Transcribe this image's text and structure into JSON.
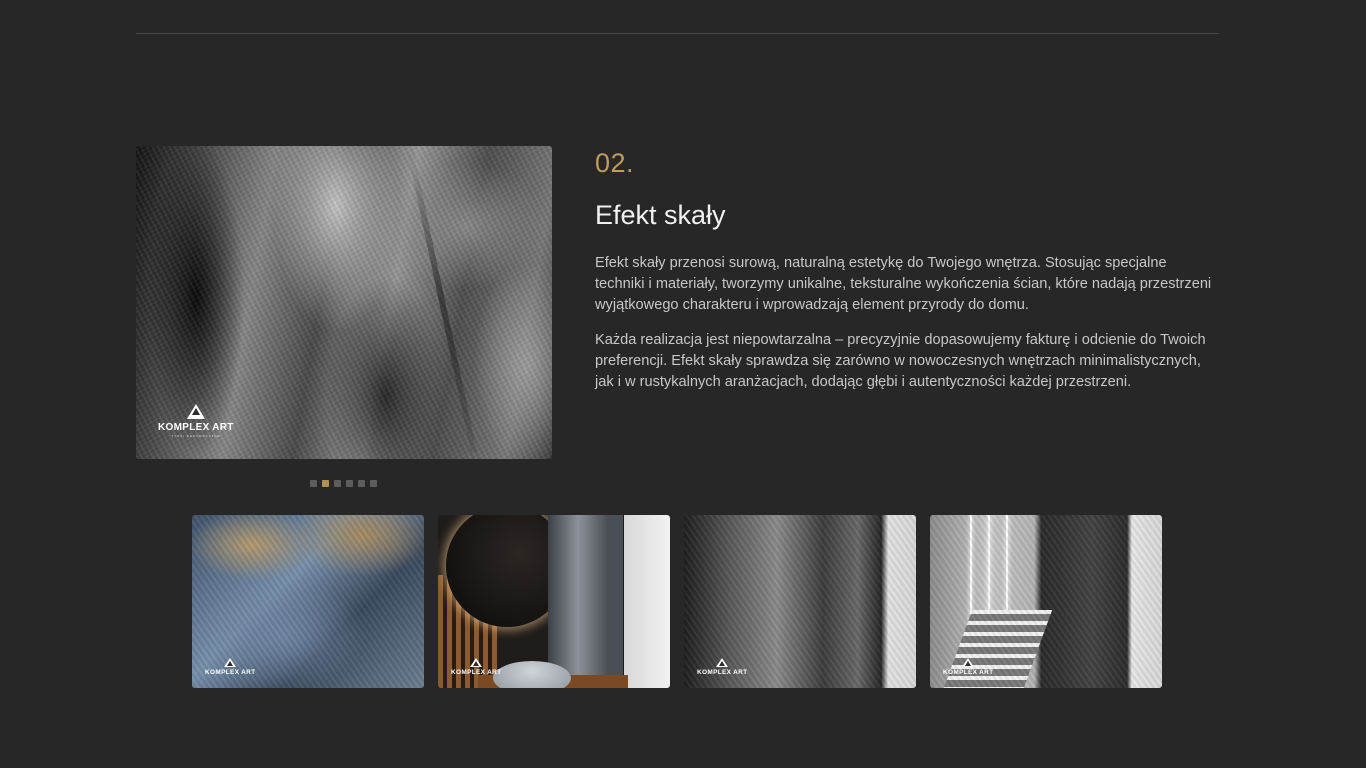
{
  "section": {
    "number": "02.",
    "title": "Efekt skały",
    "paragraphs": [
      "Efekt skały przenosi surową, naturalną estetykę do Twojego wnętrza. Stosując specjalne techniki i materiały, tworzymy unikalne, teksturalne wykończenia ścian, które nadają przestrzeni wyjątkowego charakteru i wprowadzają element przyrody do domu.",
      "Każda realizacja jest niepowtarzalna – precyzyjnie dopasowujemy fakturę i odcienie do Twoich preferencji. Efekt skały sprawdza się zarówno w nowoczesnych wnętrzach minimalistycznych, jak i w rustykalnych aranżacjach, dodając głębi i autentyczności każdej przestrzeni."
    ]
  },
  "gallery": {
    "main_image": {
      "subject": "rock-texture-closeup"
    },
    "logo": {
      "name": "KOMPLEX ART",
      "tagline": "TYNKI DEKORACYJNE"
    },
    "dots": {
      "count": 6,
      "active_index": 1
    },
    "thumbnails": [
      {
        "subject": "rock-wall-blue-grey"
      },
      {
        "subject": "bathroom-round-mirror-rock-wall"
      },
      {
        "subject": "rock-texture-dark-closeup"
      },
      {
        "subject": "staircase-led-rock-wall"
      }
    ]
  },
  "colors": {
    "background": "#272727",
    "accent_gold": "#c09a5e",
    "active_dot": "#b28f55",
    "inactive_dot": "#5d5d5d"
  }
}
